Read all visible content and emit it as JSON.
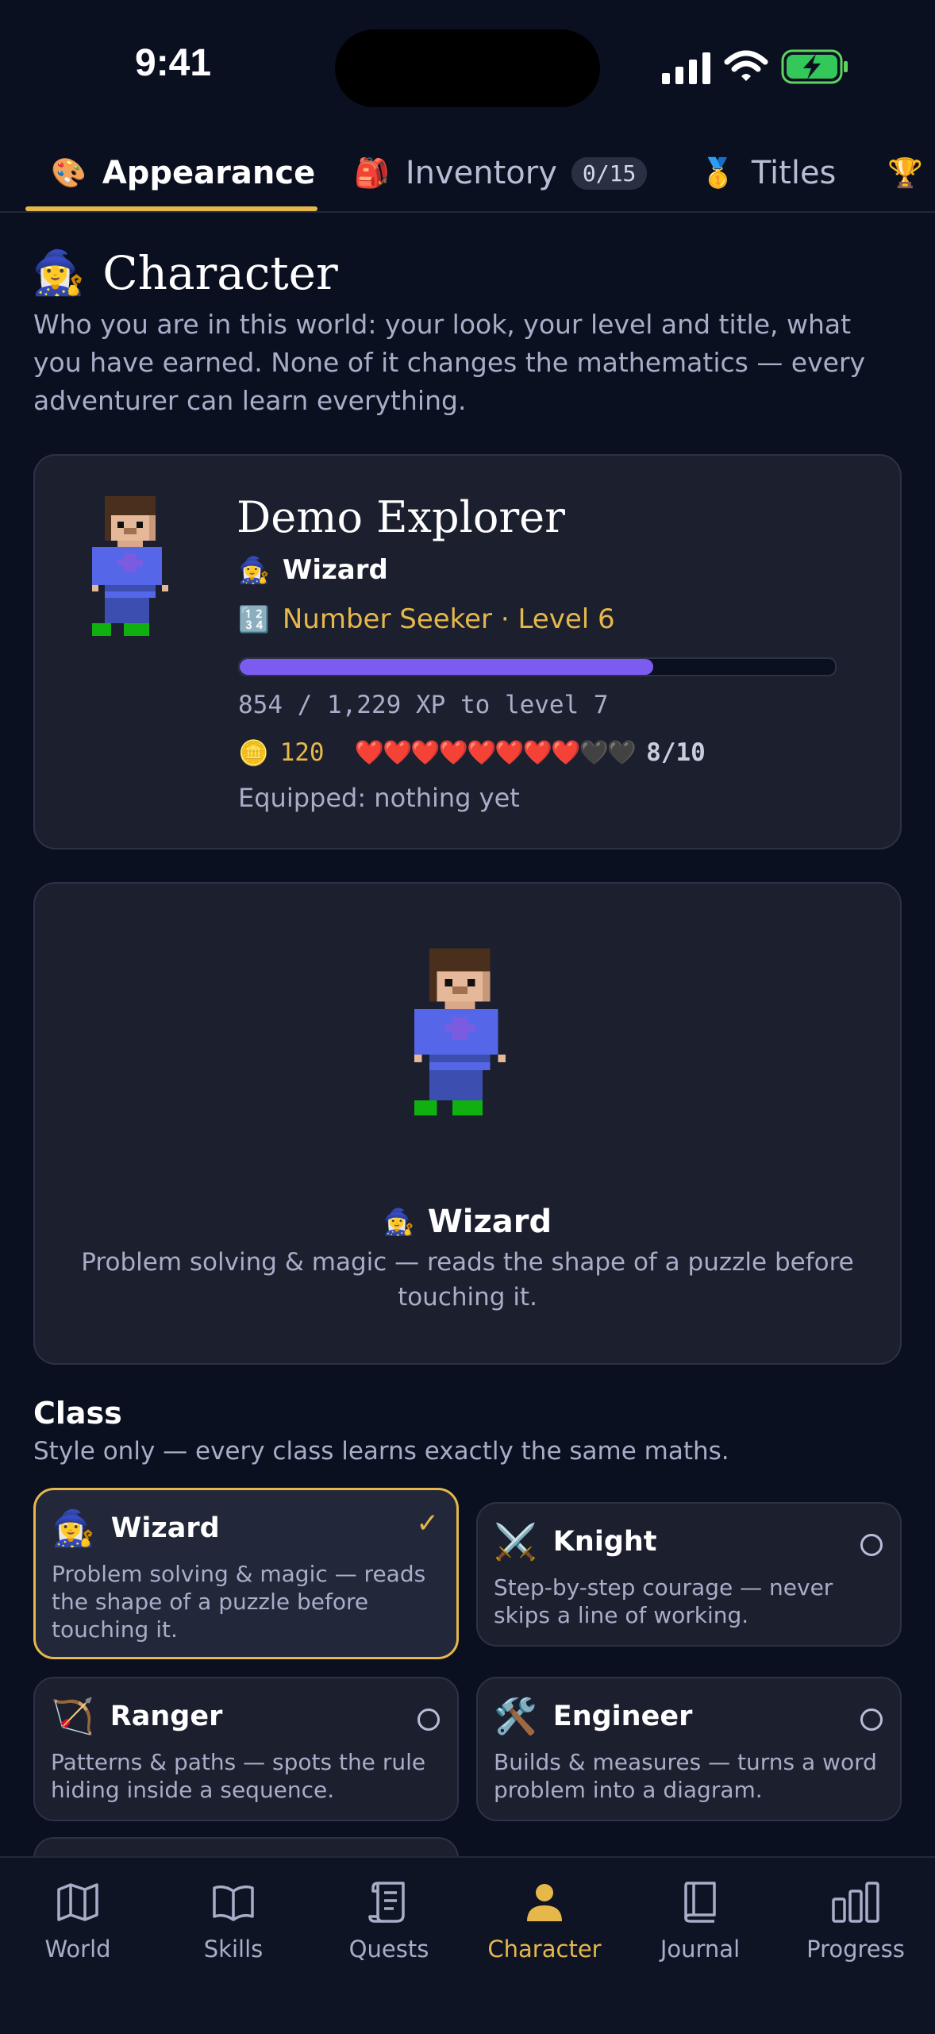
{
  "status": {
    "time": "9:41"
  },
  "tabs": [
    {
      "emoji": "🎨",
      "label": "Appearance"
    },
    {
      "emoji": "🎒",
      "label": "Inventory",
      "badge": "0/15"
    },
    {
      "emoji": "🥇",
      "label": "Titles"
    },
    {
      "emoji": "🏆",
      "label": ""
    }
  ],
  "header": {
    "emoji": "🧙‍♀️",
    "title": "Character",
    "intro": "Who you are in this world: your look, your level and title, what you have earned. None of it changes the mathematics — every adventurer can learn everything."
  },
  "profile": {
    "name": "Demo Explorer",
    "class_emoji": "🧙‍♀️",
    "class_name": "Wizard",
    "title_emoji": "🔢",
    "title_text": "Number Seeker · Level 6",
    "xp_progress": 0.694,
    "xp_text": "854 / 1,229 XP to level 7",
    "coin_emoji": "🪙",
    "coins": "120",
    "hearts_full": "❤️❤️❤️❤️❤️❤️❤️❤️",
    "hearts_empty": "🖤🖤",
    "hearts_count": "8/10",
    "equipped": "Equipped: nothing yet"
  },
  "preview": {
    "class_emoji": "🧙‍♀️",
    "class_name": "Wizard",
    "description": "Problem solving & magic — reads the shape of a puzzle before touching it."
  },
  "class_section": {
    "title": "Class",
    "subtitle": "Style only — every class learns exactly the same maths.",
    "classes": [
      {
        "emoji": "🧙‍♀️",
        "name": "Wizard",
        "desc": "Problem solving & magic — reads the shape of a puzzle before touching it.",
        "selected": true,
        "check": "✓"
      },
      {
        "emoji": "⚔️",
        "name": "Knight",
        "desc": "Step-by-step courage — never skips a line of working.",
        "selected": false
      },
      {
        "emoji": "🏹",
        "name": "Ranger",
        "desc": "Patterns & paths — spots the rule hiding inside a sequence.",
        "selected": false
      },
      {
        "emoji": "🛠️",
        "name": "Engineer",
        "desc": "Builds & measures — turns a word problem into a diagram.",
        "selected": false
      }
    ]
  },
  "nav": [
    {
      "label": "World",
      "icon": "map-icon"
    },
    {
      "label": "Skills",
      "icon": "book-open-icon"
    },
    {
      "label": "Quests",
      "icon": "scroll-icon"
    },
    {
      "label": "Character",
      "icon": "person-icon",
      "active": true
    },
    {
      "label": "Journal",
      "icon": "journal-icon"
    },
    {
      "label": "Progress",
      "icon": "bar-chart-icon"
    }
  ],
  "colors": {
    "accent": "#e6b84a",
    "xp": "#7c5cf0",
    "bg": "#0b1020",
    "card": "#1b1f2e"
  }
}
